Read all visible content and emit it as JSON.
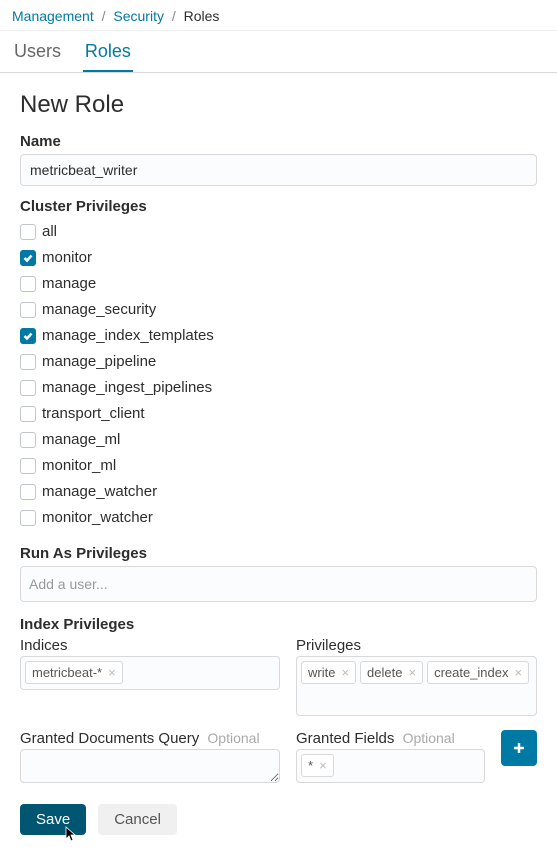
{
  "breadcrumbs": {
    "management": "Management",
    "security": "Security",
    "roles": "Roles"
  },
  "tabs": {
    "users": "Users",
    "roles": "Roles"
  },
  "title": "New Role",
  "name": {
    "label": "Name",
    "value": "metricbeat_writer"
  },
  "cluster_privileges": {
    "label": "Cluster Privileges",
    "items": [
      {
        "key": "all",
        "label": "all",
        "checked": false
      },
      {
        "key": "monitor",
        "label": "monitor",
        "checked": true
      },
      {
        "key": "manage",
        "label": "manage",
        "checked": false
      },
      {
        "key": "manage_security",
        "label": "manage_security",
        "checked": false
      },
      {
        "key": "manage_index_templates",
        "label": "manage_index_templates",
        "checked": true
      },
      {
        "key": "manage_pipeline",
        "label": "manage_pipeline",
        "checked": false
      },
      {
        "key": "manage_ingest_pipelines",
        "label": "manage_ingest_pipelines",
        "checked": false
      },
      {
        "key": "transport_client",
        "label": "transport_client",
        "checked": false
      },
      {
        "key": "manage_ml",
        "label": "manage_ml",
        "checked": false
      },
      {
        "key": "monitor_ml",
        "label": "monitor_ml",
        "checked": false
      },
      {
        "key": "manage_watcher",
        "label": "manage_watcher",
        "checked": false
      },
      {
        "key": "monitor_watcher",
        "label": "monitor_watcher",
        "checked": false
      }
    ]
  },
  "run_as": {
    "label": "Run As Privileges",
    "placeholder": "Add a user..."
  },
  "index_privileges": {
    "label": "Index Privileges",
    "indices_label": "Indices",
    "privileges_label": "Privileges",
    "indices": [
      "metricbeat-*"
    ],
    "privileges": [
      "write",
      "delete",
      "create_index"
    ],
    "granted_docs_label": "Granted Documents Query",
    "granted_fields_label": "Granted Fields",
    "optional": "Optional",
    "granted_fields": [
      "*"
    ]
  },
  "buttons": {
    "save": "Save",
    "cancel": "Cancel"
  }
}
